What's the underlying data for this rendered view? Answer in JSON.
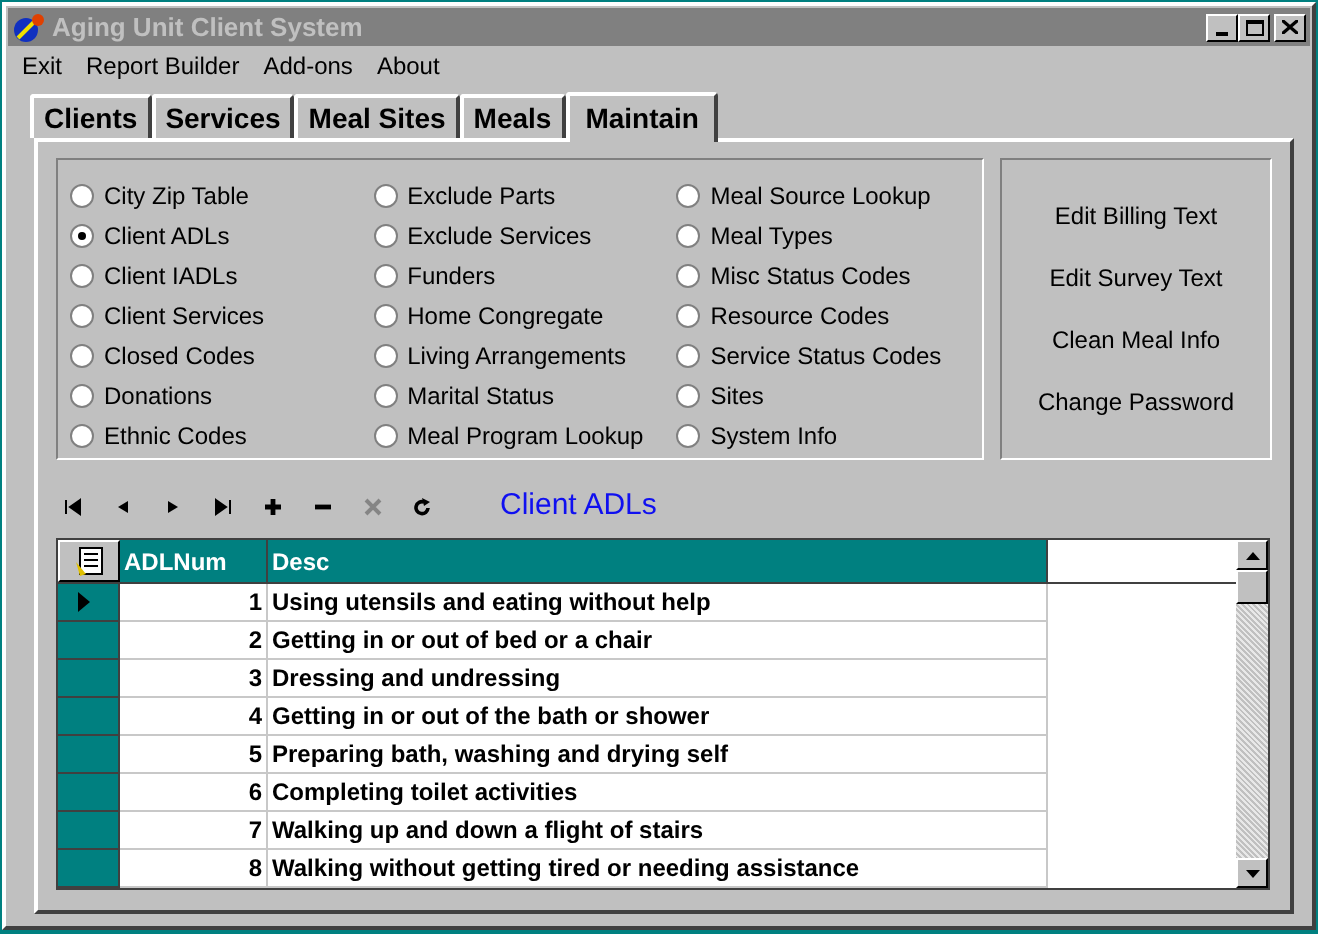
{
  "window": {
    "title": "Aging Unit Client System",
    "active": false
  },
  "menu": [
    "Exit",
    "Report Builder",
    "Add-ons",
    "About"
  ],
  "tabs": [
    {
      "label": "Clients",
      "selected": false
    },
    {
      "label": "Services",
      "selected": false
    },
    {
      "label": "Meal Sites",
      "selected": false
    },
    {
      "label": "Meals",
      "selected": false
    },
    {
      "label": "Maintain",
      "selected": true
    }
  ],
  "options": [
    [
      {
        "label": "City Zip Table",
        "selected": false
      },
      {
        "label": "Client ADLs",
        "selected": true
      },
      {
        "label": "Client IADLs",
        "selected": false
      },
      {
        "label": "Client Services",
        "selected": false
      },
      {
        "label": "Closed Codes",
        "selected": false
      },
      {
        "label": "Donations",
        "selected": false
      },
      {
        "label": "Ethnic Codes",
        "selected": false
      }
    ],
    [
      {
        "label": "Exclude Parts",
        "selected": false
      },
      {
        "label": "Exclude Services",
        "selected": false
      },
      {
        "label": "Funders",
        "selected": false
      },
      {
        "label": "Home Congregate",
        "selected": false
      },
      {
        "label": "Living Arrangements",
        "selected": false
      },
      {
        "label": "Marital Status",
        "selected": false
      },
      {
        "label": "Meal Program Lookup",
        "selected": false
      }
    ],
    [
      {
        "label": "Meal Source Lookup",
        "selected": false
      },
      {
        "label": "Meal Types",
        "selected": false
      },
      {
        "label": "Misc Status Codes",
        "selected": false
      },
      {
        "label": "Resource Codes",
        "selected": false
      },
      {
        "label": "Service Status Codes",
        "selected": false
      },
      {
        "label": "Sites",
        "selected": false
      },
      {
        "label": "System Info",
        "selected": false
      }
    ]
  ],
  "actions": [
    "Edit Billing Text",
    "Edit Survey Text",
    "Clean Meal Info",
    "Change Password"
  ],
  "toolbar": [
    {
      "kind": "first",
      "disabled": false
    },
    {
      "kind": "prev",
      "disabled": false
    },
    {
      "kind": "next",
      "disabled": false
    },
    {
      "kind": "last",
      "disabled": false
    },
    {
      "kind": "add",
      "disabled": false
    },
    {
      "kind": "delete",
      "disabled": false
    },
    {
      "kind": "cancel",
      "disabled": true
    },
    {
      "kind": "refresh",
      "disabled": false
    }
  ],
  "table": {
    "title": "Client ADLs",
    "columns": [
      "ADLNum",
      "Desc"
    ],
    "rows": [
      {
        "cells": [
          "1",
          "Using utensils and eating without help"
        ],
        "selected": true
      },
      {
        "cells": [
          "2",
          "Getting in or out of bed or a chair"
        ],
        "selected": false
      },
      {
        "cells": [
          "3",
          "Dressing and undressing"
        ],
        "selected": false
      },
      {
        "cells": [
          "4",
          "Getting in or out of the bath or shower"
        ],
        "selected": false
      },
      {
        "cells": [
          "5",
          "Preparing bath, washing and drying self"
        ],
        "selected": false
      },
      {
        "cells": [
          "6",
          "Completing toilet activities"
        ],
        "selected": false
      },
      {
        "cells": [
          "7",
          "Walking up and down a flight of stairs"
        ],
        "selected": false
      },
      {
        "cells": [
          "8",
          "Walking without getting tired or needing assistance"
        ],
        "selected": false
      }
    ]
  }
}
